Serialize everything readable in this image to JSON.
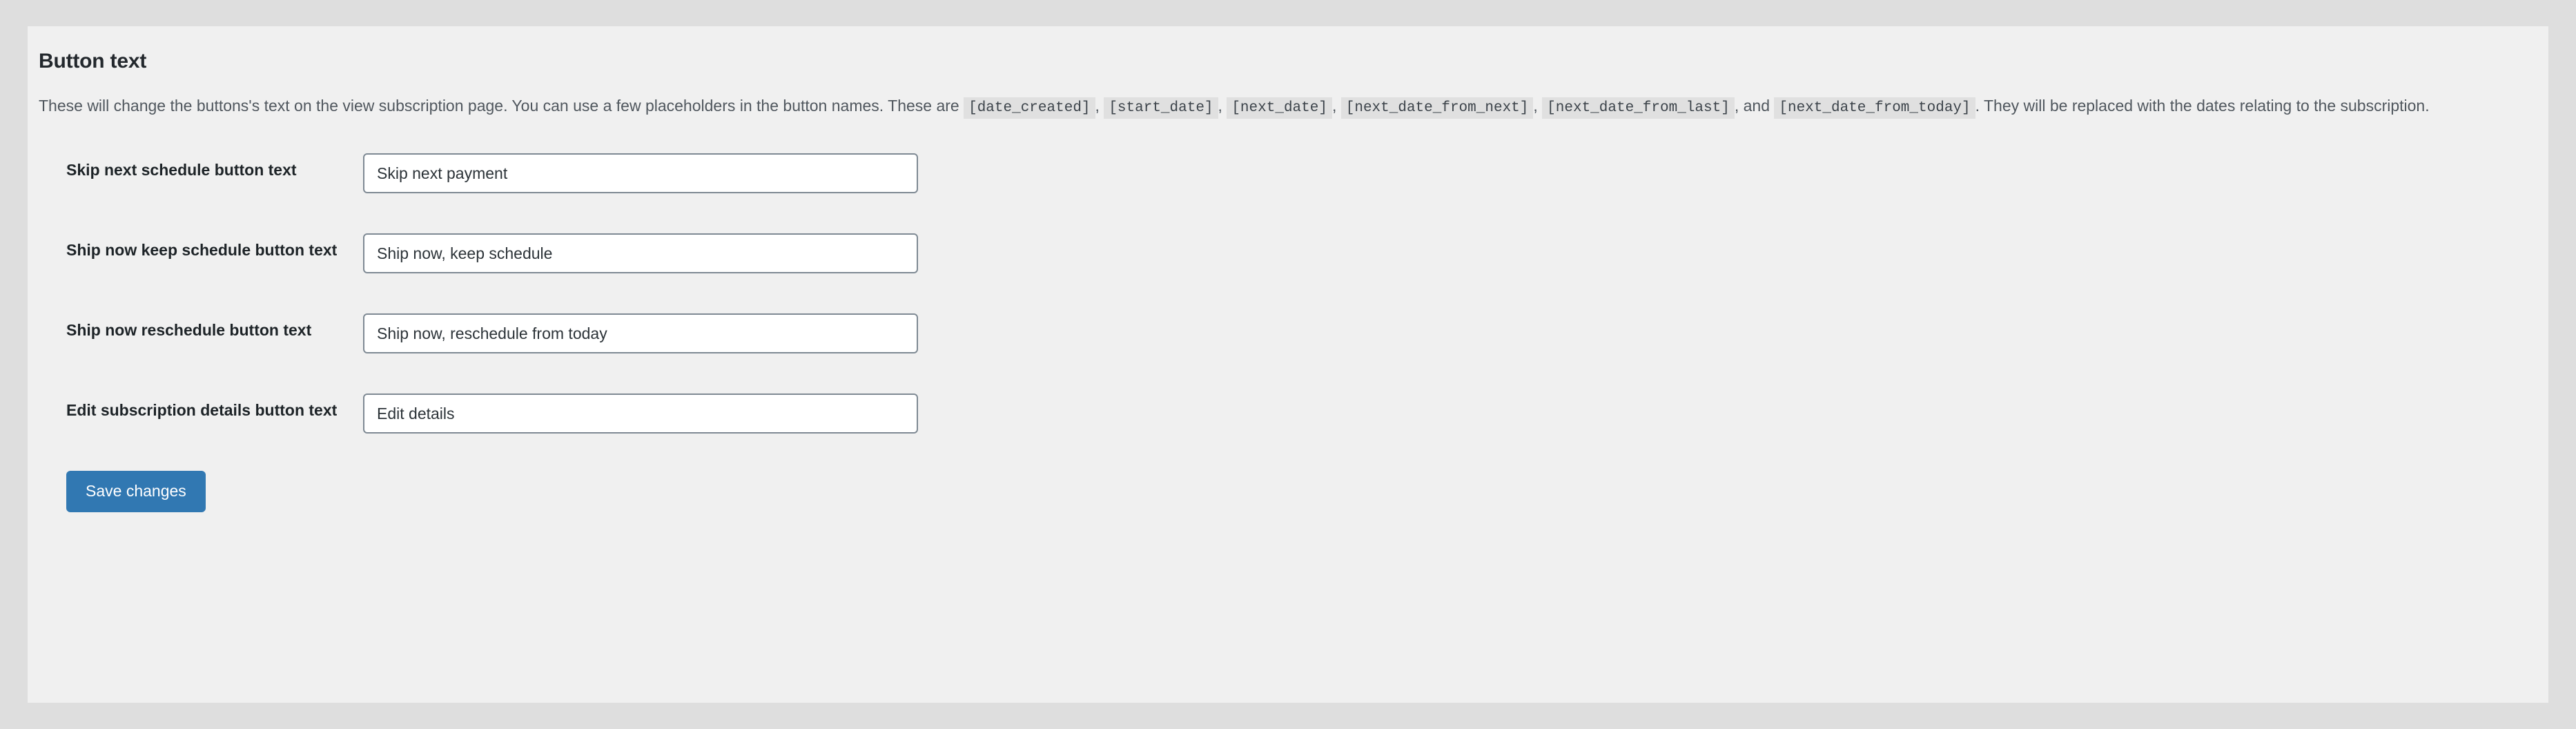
{
  "section": {
    "title": "Button text",
    "description": {
      "lead": "These will change the buttons's text on the view subscription page. You can use a few placeholders in the button names. These are",
      "separator": ",",
      "conjunction": ", and",
      "trailing": ". They will be replaced with the dates relating to the subscription.",
      "placeholders": [
        "[date_created]",
        "[start_date]",
        "[next_date]",
        "[next_date_from_next]",
        "[next_date_from_last]",
        "[next_date_from_today]"
      ]
    }
  },
  "fields": [
    {
      "label": "Skip next schedule button text",
      "value": "Skip next payment"
    },
    {
      "label": "Ship now keep schedule button text",
      "value": "Ship now, keep schedule"
    },
    {
      "label": "Ship now reschedule button text",
      "value": "Ship now, reschedule from today"
    },
    {
      "label": "Edit subscription details button text",
      "value": "Edit details"
    }
  ],
  "actions": {
    "save_label": "Save changes"
  },
  "colors": {
    "page_background": "#dedede",
    "card_background": "#f0f0f0",
    "primary_button": "#3178b2",
    "input_border": "#7e8993",
    "code_background": "#e0e0e0",
    "heading_text": "#23282d",
    "body_text": "#50575e"
  }
}
